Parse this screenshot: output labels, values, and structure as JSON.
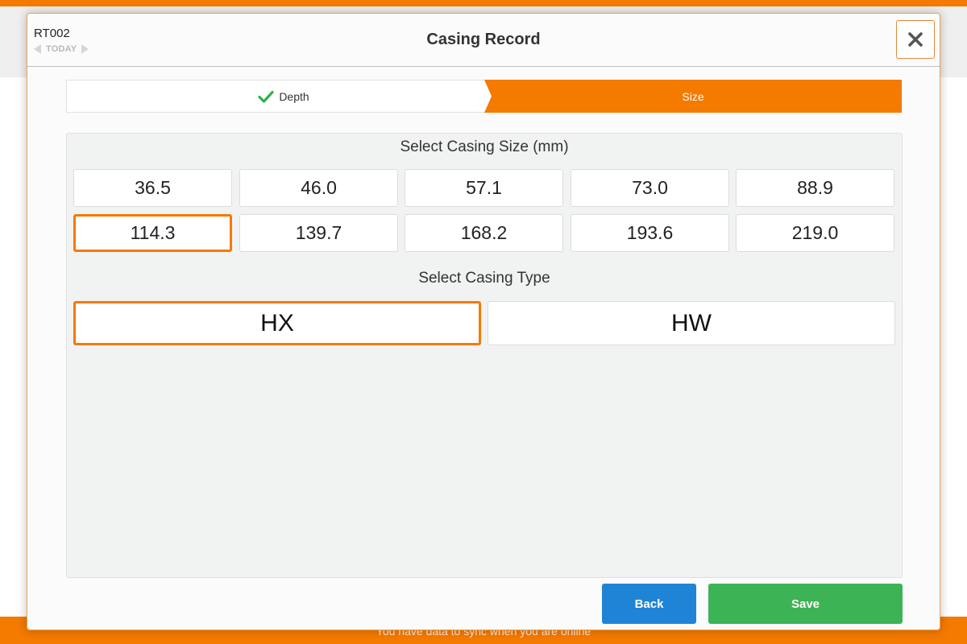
{
  "app": {
    "footer_text": "You have data to sync when you are online"
  },
  "modal": {
    "record_id": "RT002",
    "date_label": "TODAY",
    "title": "Casing Record",
    "close_icon": "close-icon"
  },
  "stepper": {
    "steps": [
      {
        "label": "Depth",
        "status": "complete",
        "icon": "check-icon"
      },
      {
        "label": "Size",
        "status": "active"
      }
    ]
  },
  "size_section": {
    "title": "Select Casing Size (mm)",
    "options": [
      "36.5",
      "46.0",
      "57.1",
      "73.0",
      "88.9",
      "114.3",
      "139.7",
      "168.2",
      "193.6",
      "219.0"
    ],
    "selected": "114.3"
  },
  "type_section": {
    "title": "Select Casing Type",
    "options": [
      "HX",
      "HW"
    ],
    "selected": "HX"
  },
  "actions": {
    "back_label": "Back",
    "save_label": "Save"
  },
  "colors": {
    "accent": "#f47a00",
    "back_button": "#1f84d6",
    "save_button": "#3cb354",
    "check": "#2db34a"
  }
}
